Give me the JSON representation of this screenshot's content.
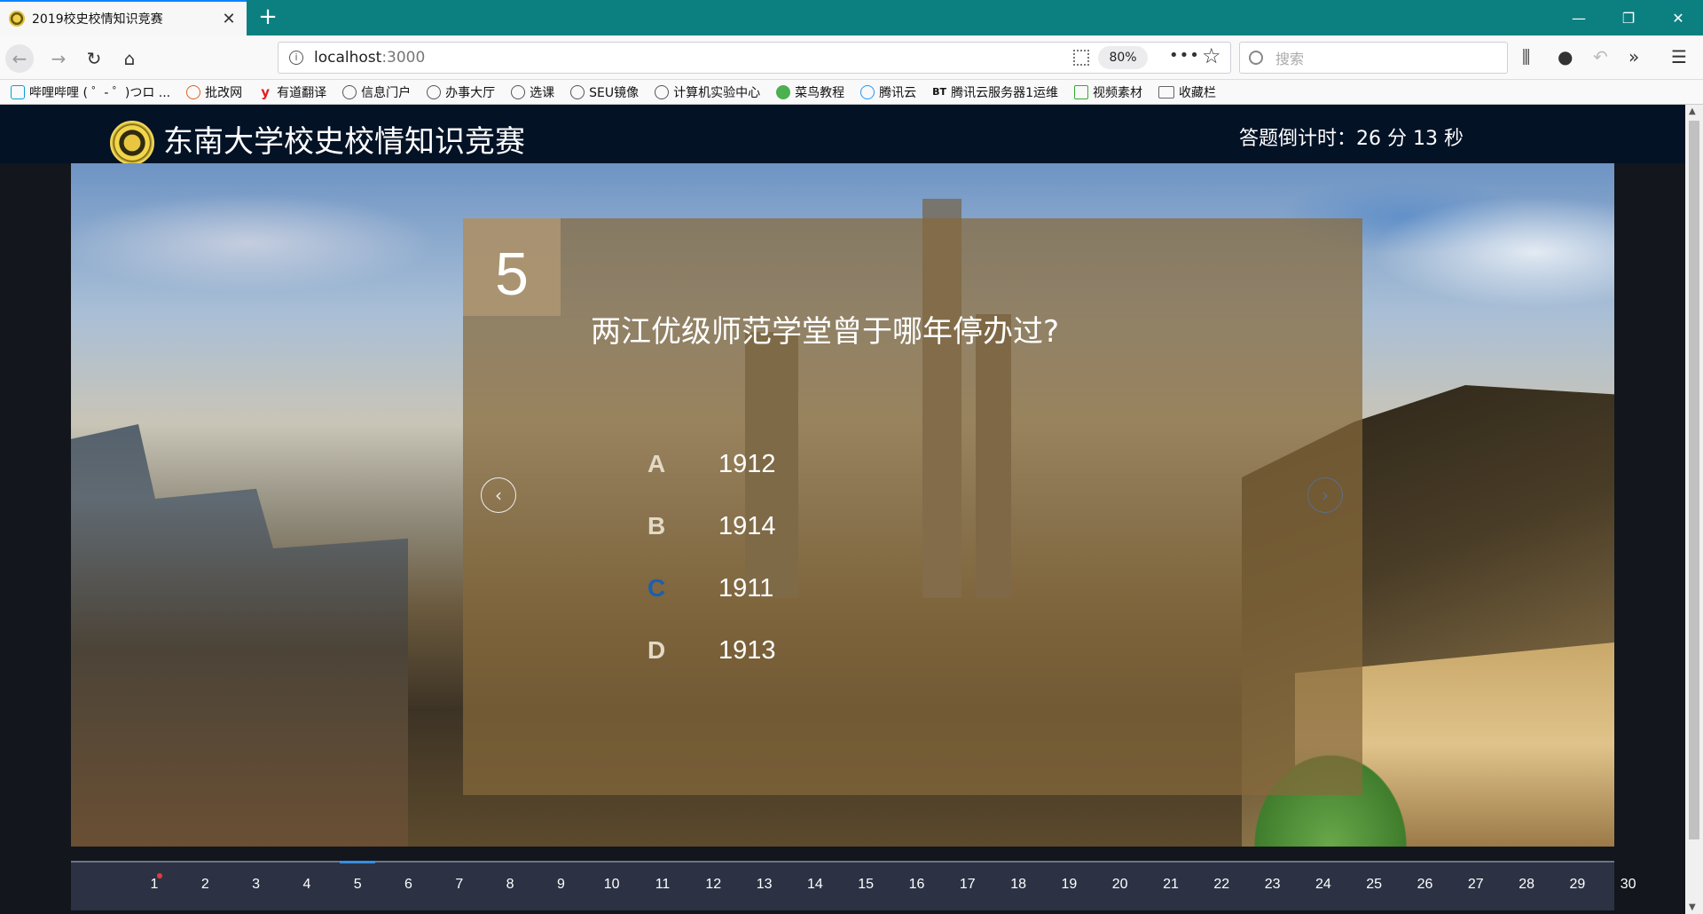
{
  "browser": {
    "tab_title": "2019校史校情知识竞赛",
    "url_host": "localhost",
    "url_port": ":3000",
    "zoom": "80%",
    "search_placeholder": "搜索",
    "bookmarks": [
      {
        "label": "哔哩哔哩 ( ゜- ゜)つロ ...",
        "icon": "bilibili-icon"
      },
      {
        "label": "批改网",
        "icon": "cloud-icon"
      },
      {
        "label": "有道翻译",
        "icon": "youdao-icon"
      },
      {
        "label": "信息门户",
        "icon": "globe-icon"
      },
      {
        "label": "办事大厅",
        "icon": "globe-icon"
      },
      {
        "label": "选课",
        "icon": "globe-icon"
      },
      {
        "label": "SEU镜像",
        "icon": "globe-icon"
      },
      {
        "label": "计算机实验中心",
        "icon": "globe-icon"
      },
      {
        "label": "菜鸟教程",
        "icon": "runoob-icon"
      },
      {
        "label": "腾讯云",
        "icon": "tencent-cloud-icon"
      },
      {
        "label": "腾讯云服务器1运维",
        "icon": "bt-icon"
      },
      {
        "label": "视频素材",
        "icon": "picture-icon"
      },
      {
        "label": "收藏栏",
        "icon": "folder-icon"
      }
    ]
  },
  "header": {
    "title": "东南大学校史校情知识竞赛",
    "countdown": "答题倒计时：26 分 13 秒"
  },
  "question": {
    "number": "5",
    "text": "两江优级师范学堂曾于哪年停办过?",
    "options": [
      {
        "letter": "A",
        "text": "1912",
        "selected": false
      },
      {
        "letter": "B",
        "text": "1914",
        "selected": false
      },
      {
        "letter": "C",
        "text": "1911",
        "selected": true
      },
      {
        "letter": "D",
        "text": "1913",
        "selected": false
      }
    ]
  },
  "pagination": {
    "items": [
      "1",
      "2",
      "3",
      "4",
      "5",
      "6",
      "7",
      "8",
      "9",
      "10",
      "11",
      "12",
      "13",
      "14",
      "15",
      "16",
      "17",
      "18",
      "19",
      "20",
      "21",
      "22",
      "23",
      "24",
      "25",
      "26",
      "27",
      "28",
      "29",
      "30"
    ],
    "active": "5",
    "marked": "1"
  },
  "colors": {
    "accent": "#0c8080",
    "active_indicator": "#3b8de0",
    "selected_letter": "#1b5fb0"
  }
}
